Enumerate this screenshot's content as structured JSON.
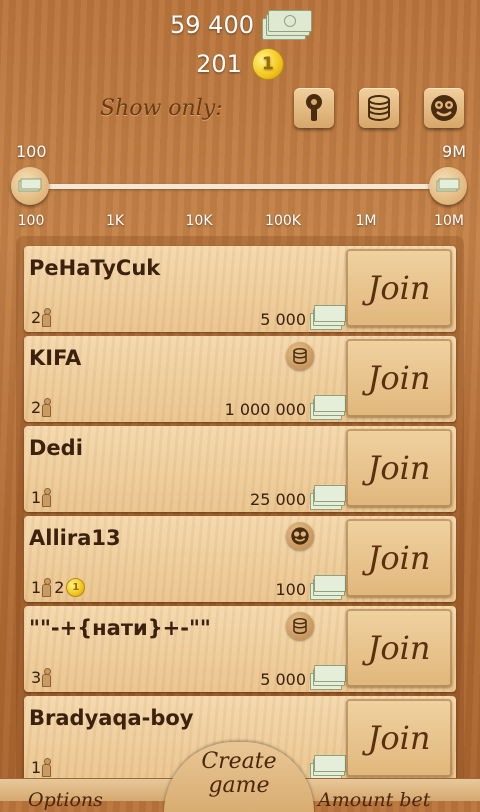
{
  "header": {
    "money_balance": "59 400",
    "coin_balance": "201",
    "coin_symbol": "1",
    "show_only_label": "Show only:",
    "filter_buttons": [
      {
        "icon": "keyhole-icon"
      },
      {
        "icon": "coin-stack-icon"
      },
      {
        "icon": "crazy-face-icon"
      }
    ]
  },
  "slider": {
    "min_value": "100",
    "max_value": "9M",
    "ticks": [
      "100",
      "1K",
      "10K",
      "100K",
      "1M",
      "10M"
    ]
  },
  "rooms": [
    {
      "name": "PeHaTyCuk",
      "players": "2",
      "bet": "5 000",
      "mode_icon": "",
      "join_label": "Join"
    },
    {
      "name": "KIFA",
      "players": "2",
      "bet": "1 000 000",
      "mode_icon": "coin-stack-icon",
      "join_label": "Join"
    },
    {
      "name": "Dedi",
      "players": "1",
      "bet": "25 000",
      "mode_icon": "",
      "join_label": "Join"
    },
    {
      "name": "Allira13",
      "players": "1",
      "players2": "2",
      "bet": "100",
      "mode_icon": "crazy-face-icon",
      "join_label": "Join"
    },
    {
      "name": "\"\"-+{нати}+-\"\"",
      "players": "3",
      "bet": "5 000",
      "mode_icon": "coin-stack-icon",
      "join_label": "Join"
    },
    {
      "name": "Bradyaqa-boy",
      "players": "1",
      "bet": "",
      "mode_icon": "",
      "join_label": "Join"
    }
  ],
  "bottom": {
    "options_label": "Options",
    "create_label_1": "Create",
    "create_label_2": "game",
    "amount_label": "Amount bet"
  }
}
